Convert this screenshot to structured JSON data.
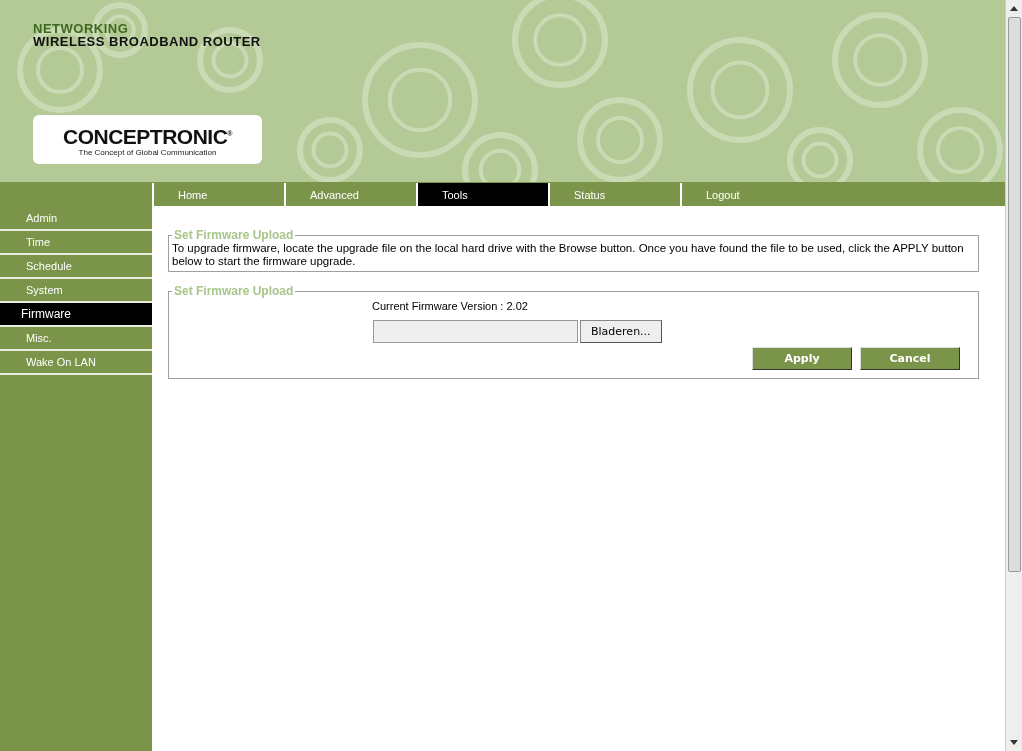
{
  "header": {
    "category": "NETWORKING",
    "product": "WIRELESS BROADBAND ROUTER",
    "logo": {
      "brand": "CONCEPTRONIC",
      "mark": "®",
      "tagline": "The Concept of Global Communication"
    }
  },
  "tabs": [
    {
      "label": "Home",
      "selected": false
    },
    {
      "label": "Advanced",
      "selected": false
    },
    {
      "label": "Tools",
      "selected": true
    },
    {
      "label": "Status",
      "selected": false
    },
    {
      "label": "Logout",
      "selected": false
    }
  ],
  "sidebar": {
    "items": [
      {
        "label": "Admin",
        "selected": false
      },
      {
        "label": "Time",
        "selected": false
      },
      {
        "label": "Schedule",
        "selected": false
      },
      {
        "label": "System",
        "selected": false
      },
      {
        "label": "Firmware",
        "selected": true
      },
      {
        "label": "Misc.",
        "selected": false
      },
      {
        "label": "Wake On LAN",
        "selected": false
      }
    ]
  },
  "info_section": {
    "legend": "Set Firmware Upload",
    "text": "To upgrade firmware, locate the upgrade file on the local hard drive with the Browse button. Once you have found the file to be used, click the APPLY button below to start the firmware upgrade."
  },
  "upload_section": {
    "legend": "Set Firmware Upload",
    "version_label": "Current Firmware Version : 2.02",
    "browse_button": "Bladeren...",
    "buttons": [
      "Apply",
      "Cancel"
    ]
  }
}
